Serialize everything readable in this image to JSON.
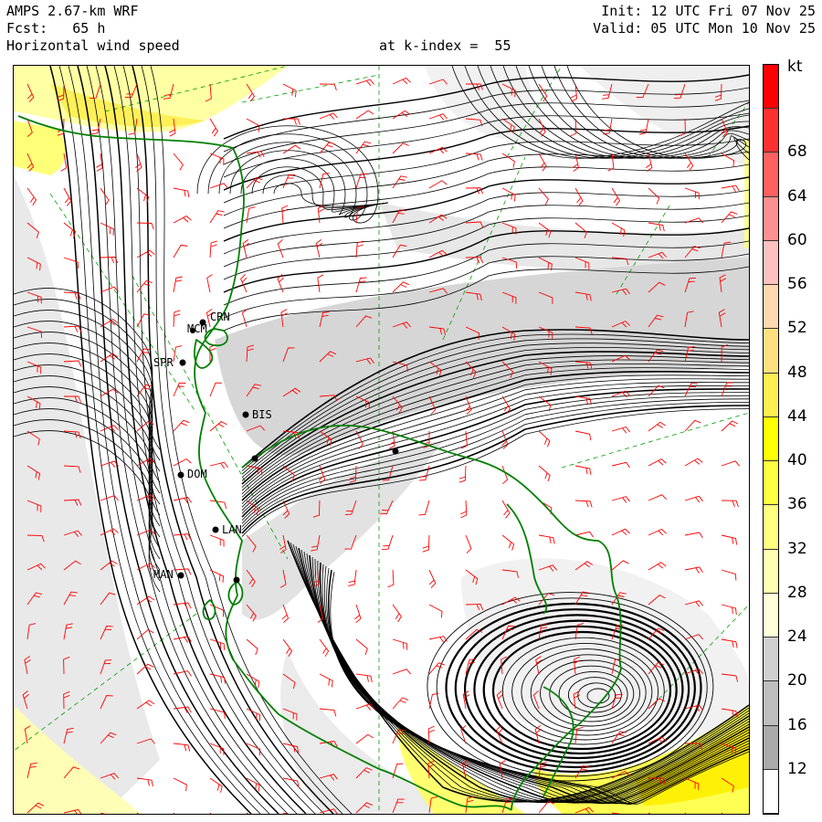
{
  "header": {
    "model": "AMPS 2.67-km WRF",
    "init": "Init: 12 UTC Fri 07 Nov 25",
    "fcst": "Fcst:   65 h",
    "valid": "Valid: 05 UTC Mon 10 Nov 25",
    "field": "Horizontal wind speed",
    "level": "at k-index =  55"
  },
  "colorbar": {
    "unit": "kt",
    "labels": [
      "68",
      "64",
      "60",
      "56",
      "52",
      "48",
      "44",
      "40",
      "36",
      "32",
      "28",
      "24",
      "20",
      "16",
      "12"
    ],
    "colors": [
      "#ff0000",
      "#ff3030",
      "#ff6060",
      "#ff9090",
      "#ffc0c0",
      "#ffd8b0",
      "#ffe080",
      "#ffee50",
      "#ffff00",
      "#ffff40",
      "#ffff80",
      "#ffffb0",
      "#ffffd8",
      "#d0d0d0",
      "#bebebe",
      "#aaaaaa",
      "#ffffff"
    ]
  },
  "stations": [
    "CRN",
    "MCM",
    "SPR",
    "BIS",
    "DOM",
    "LAN",
    "MAN"
  ],
  "colors": {
    "coastline": "#008000",
    "barbs": "#ff0000",
    "streamlines": "#000000",
    "grid": "#00a000"
  }
}
